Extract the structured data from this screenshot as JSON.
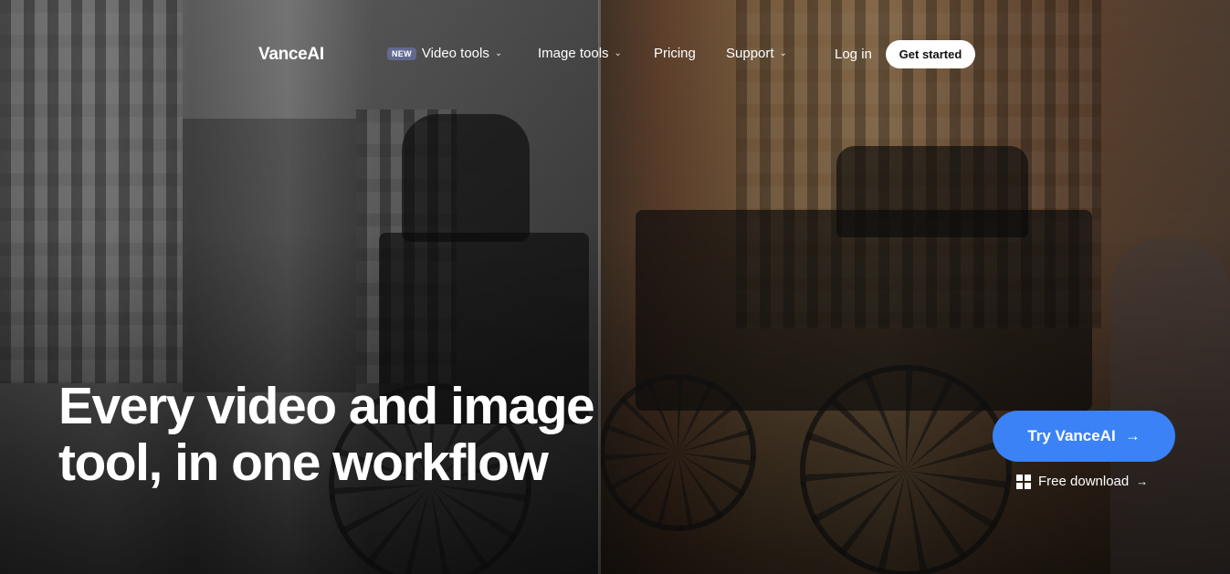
{
  "brand": {
    "logo_text": "VanceAI"
  },
  "nav": {
    "items": [
      {
        "label": "Video tools",
        "badge": "NEW",
        "has_dropdown": true
      },
      {
        "label": "Image tools",
        "has_dropdown": true
      },
      {
        "label": "Pricing",
        "has_dropdown": false
      },
      {
        "label": "Support",
        "has_dropdown": true
      }
    ],
    "login_label": "Log in",
    "get_started_label": "Get started"
  },
  "hero": {
    "headline_line1": "Every video and image",
    "headline_line2": "tool, in one workflow",
    "cta_label": "Try VanceAI",
    "cta_arrow": "→",
    "free_download_label": "Free download",
    "free_download_arrow": "→",
    "accent_color": "#3b82f6"
  },
  "icons": {
    "chevron": "⌄",
    "windows": "windows-icon"
  }
}
